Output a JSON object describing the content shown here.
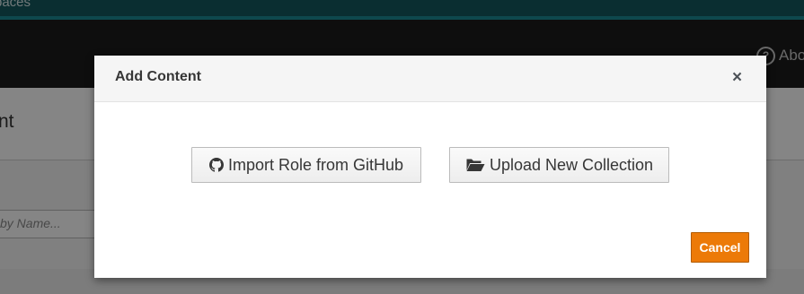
{
  "background": {
    "top_text": "paces",
    "about_label": "Abo",
    "title_text": "nt",
    "search_placeholder": "by Name..."
  },
  "modal": {
    "title": "Add Content",
    "close_symbol": "×",
    "buttons": {
      "import_github": "Import Role from GitHub",
      "upload_collection": "Upload New Collection"
    },
    "cancel_label": "Cancel"
  },
  "colors": {
    "accent": "#ec7a08",
    "header_strip": "#14595e",
    "navbar": "#1b1b1b"
  },
  "icons": {
    "github": "github-icon",
    "folder": "folder-open-icon",
    "about": "question-circle-icon"
  }
}
